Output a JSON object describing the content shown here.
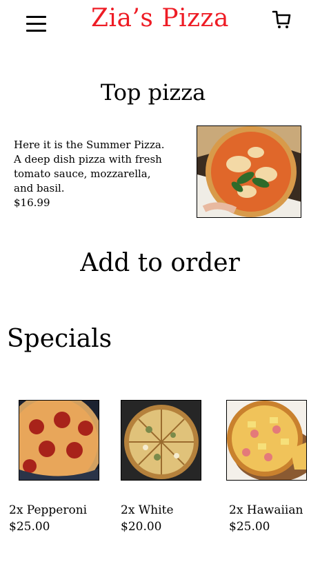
{
  "header": {
    "brand": "Zia’s Pizza",
    "brand_color": "#ee1c25",
    "menu_icon": "hamburger-menu-icon",
    "cart_icon": "shopping-cart-icon"
  },
  "top_pizza": {
    "title": "Top pizza",
    "description": "Here it is the Summer Pizza. A deep dish pizza with fresh tomato sauce, mozzarella, and basil.",
    "price": "$16.99",
    "image_alt": "summer-pizza-photo"
  },
  "add_to_order": {
    "label": "Add to order"
  },
  "specials": {
    "title": "Specials",
    "items": [
      {
        "name": "2x Pepperoni",
        "price": "$25.00",
        "image": "pepperoni-pizza-photo"
      },
      {
        "name": "2x White",
        "price": "$20.00",
        "image": "white-pizza-photo"
      },
      {
        "name": "2x Hawaiian",
        "price": "$25.00",
        "image": "hawaiian-pizza-photo"
      }
    ]
  }
}
